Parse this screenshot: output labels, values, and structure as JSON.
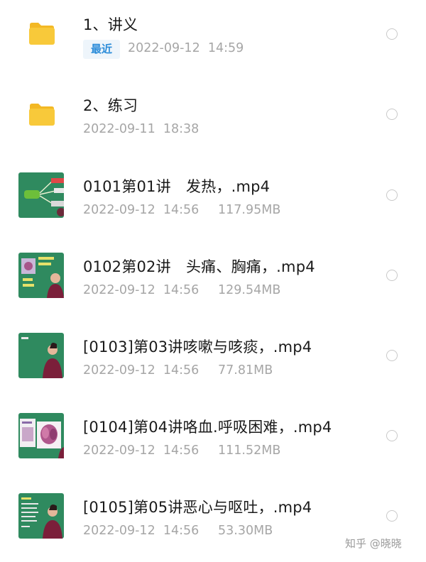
{
  "files": [
    {
      "type": "folder",
      "icon": "folder-icon",
      "name": "1、讲义",
      "badge": "最近",
      "date": "2022-09-12  14:59",
      "size": ""
    },
    {
      "type": "folder",
      "icon": "folder-icon",
      "name": "2、练习",
      "badge": "",
      "date": "2022-09-11  18:38",
      "size": ""
    },
    {
      "type": "video",
      "icon": "video-thumbnail",
      "name": "0101第01讲　发热，.mp4",
      "badge": "",
      "date": "2022-09-12  14:56",
      "size": "117.95MB"
    },
    {
      "type": "video",
      "icon": "video-thumbnail",
      "name": "0102第02讲　头痛、胸痛，.mp4",
      "badge": "",
      "date": "2022-09-12  14:56",
      "size": "129.54MB"
    },
    {
      "type": "video",
      "icon": "video-thumbnail",
      "name": "[0103]第03讲咳嗽与咳痰，.mp4",
      "badge": "",
      "date": "2022-09-12  14:56",
      "size": "77.81MB"
    },
    {
      "type": "video",
      "icon": "video-thumbnail",
      "name": "[0104]第04讲咯血.呼吸困难，.mp4",
      "badge": "",
      "date": "2022-09-12  14:56",
      "size": "111.52MB"
    },
    {
      "type": "video",
      "icon": "video-thumbnail",
      "name": "[0105]第05讲恶心与呕吐，.mp4",
      "badge": "",
      "date": "2022-09-12  14:56",
      "size": "53.30MB"
    }
  ],
  "watermark": "知乎 @晓晓",
  "colors": {
    "folder": "#f8c93a",
    "folder_tab": "#f3b824",
    "badge_text": "#2b8cd9",
    "badge_bg": "#eef5fb",
    "meta_text": "#a6a6a6",
    "thumb_board": "#2f8a5f"
  }
}
